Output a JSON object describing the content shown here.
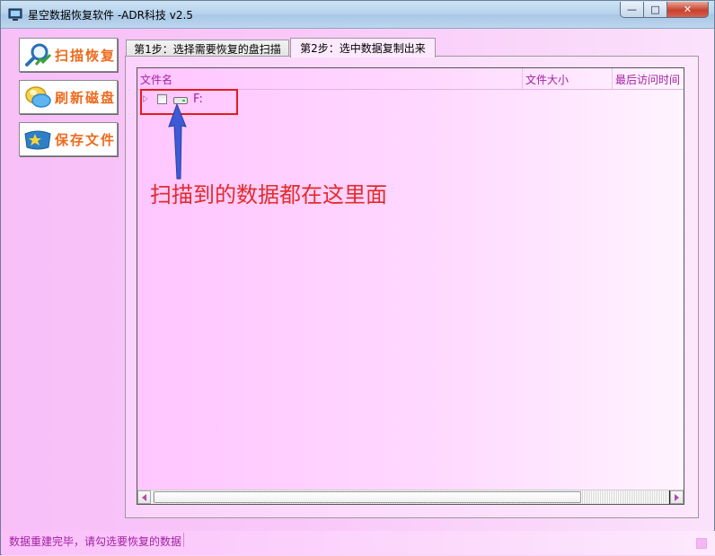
{
  "window": {
    "title": "星空数据恢复软件   -ADR科技 v2.5",
    "buttons": {
      "minimize": "—",
      "maximize": "□",
      "close": "✕"
    }
  },
  "sidebar": {
    "items": [
      {
        "label": "扫描恢复",
        "icon": "magnifier-icon"
      },
      {
        "label": "刷新磁盘",
        "icon": "refresh-disk-icon"
      },
      {
        "label": "保存文件",
        "icon": "save-file-icon"
      }
    ]
  },
  "tabs": [
    {
      "label": "第1步：选择需要恢复的盘扫描",
      "active": false
    },
    {
      "label": "第2步：选中数据复制出来",
      "active": true
    }
  ],
  "list": {
    "columns": [
      "文件名",
      "文件大小",
      "最后访问时间"
    ],
    "rows": [
      {
        "name": "F:",
        "checked": false,
        "expanded": false,
        "icon": "drive-icon"
      }
    ]
  },
  "annotation": {
    "text": "扫描到的数据都在这里面",
    "color": "#e32b2b"
  },
  "status": {
    "text": "数据重建完毕，请勾选要恢复的数据"
  },
  "colors": {
    "accent": "#a320a3",
    "button_label": "#ee6a1c",
    "highlight": "#e31b1b"
  }
}
